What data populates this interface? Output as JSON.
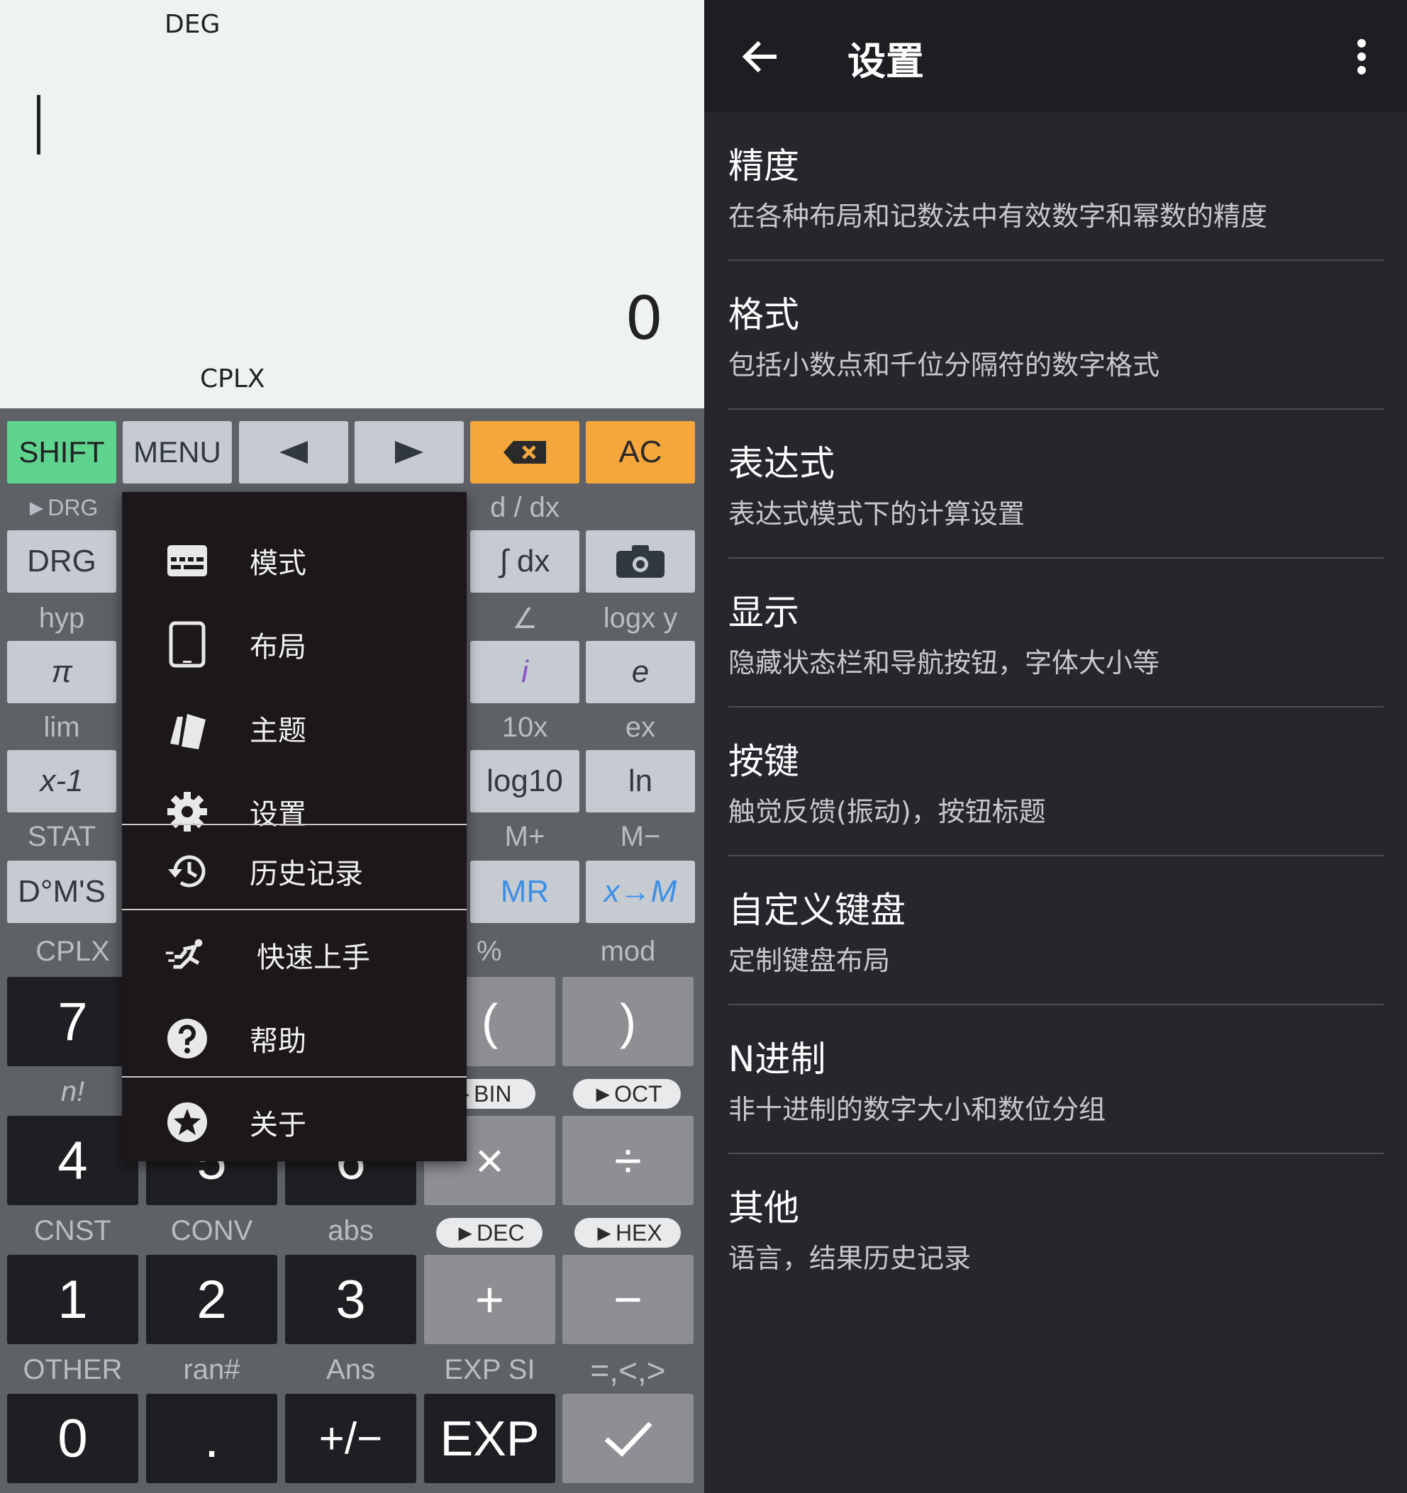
{
  "display": {
    "deg": "DEG",
    "result": "0",
    "cplx": "CPLX"
  },
  "top_keys": {
    "shift": "SHIFT",
    "menu": "MENU",
    "ac": "AC"
  },
  "sci": {
    "drg_label": "►DRG",
    "drg": "DRG",
    "d_dx": "d / dx",
    "integral": "∫ dx",
    "hyp": "hyp",
    "pi": "π",
    "angle": "∠",
    "logxy": "logx y",
    "i": "i",
    "e": "e",
    "lim": "lim",
    "inv": "x-1",
    "tenx": "10x",
    "ex": "ex",
    "log10": "log10",
    "ln": "ln",
    "stat": "STAT",
    "dms": "D°M'S",
    "mplus": "M+",
    "mminus": "M−",
    "mr": "MR",
    "xm": "x→M"
  },
  "num": {
    "cplx": "CPLX",
    "percent": "%",
    "mod": "mod",
    "k7": "7",
    "lp": "(",
    "rp": ")",
    "fact": "n!",
    "bin": "►BIN",
    "oct": "►OCT",
    "k4": "4",
    "k5": "5",
    "k6": "6",
    "mul": "×",
    "div": "÷",
    "cnst": "CNST",
    "conv": "CONV",
    "abs": "abs",
    "dec": "►DEC",
    "hex": "►HEX",
    "k1": "1",
    "k2": "2",
    "k3": "3",
    "plus": "+",
    "minus": "−",
    "other": "OTHER",
    "ran": "ran#",
    "ans": "Ans",
    "expsi": "EXP SI",
    "cmp": "=,<,>",
    "k0": "0",
    "dot": ".",
    "neg": "+/−",
    "exp": "EXP",
    "ok": "✓"
  },
  "menu": {
    "items": [
      {
        "label": "模式",
        "icon": "keyboard-icon"
      },
      {
        "label": "布局",
        "icon": "tablet-icon"
      },
      {
        "label": "主题",
        "icon": "cards-icon"
      },
      {
        "label": "设置",
        "icon": "gear-icon"
      },
      {
        "label": "历史记录",
        "icon": "history-icon"
      },
      {
        "label": "快速上手",
        "icon": "running-icon"
      },
      {
        "label": "帮助",
        "icon": "help-icon"
      },
      {
        "label": "关于",
        "icon": "star-icon"
      }
    ]
  },
  "settings": {
    "title": "设置",
    "items": [
      {
        "title": "精度",
        "subtitle": "在各种布局和记数法中有效数字和幂数的精度"
      },
      {
        "title": "格式",
        "subtitle": "包括小数点和千位分隔符的数字格式"
      },
      {
        "title": "表达式",
        "subtitle": "表达式模式下的计算设置"
      },
      {
        "title": "显示",
        "subtitle": "隐藏状态栏和导航按钮，字体大小等"
      },
      {
        "title": "按键",
        "subtitle": "触觉反馈(振动)，按钮标题"
      },
      {
        "title": "自定义键盘",
        "subtitle": "定制键盘布局"
      },
      {
        "title": "N进制",
        "subtitle": "非十进制的数字大小和数位分组"
      },
      {
        "title": "其他",
        "subtitle": "语言，结果历史记录"
      }
    ]
  },
  "colors": {
    "shift": "#5ed48e",
    "orange": "#f5a73b",
    "memory": "#3d8fe6",
    "complex": "#8a54c9"
  }
}
